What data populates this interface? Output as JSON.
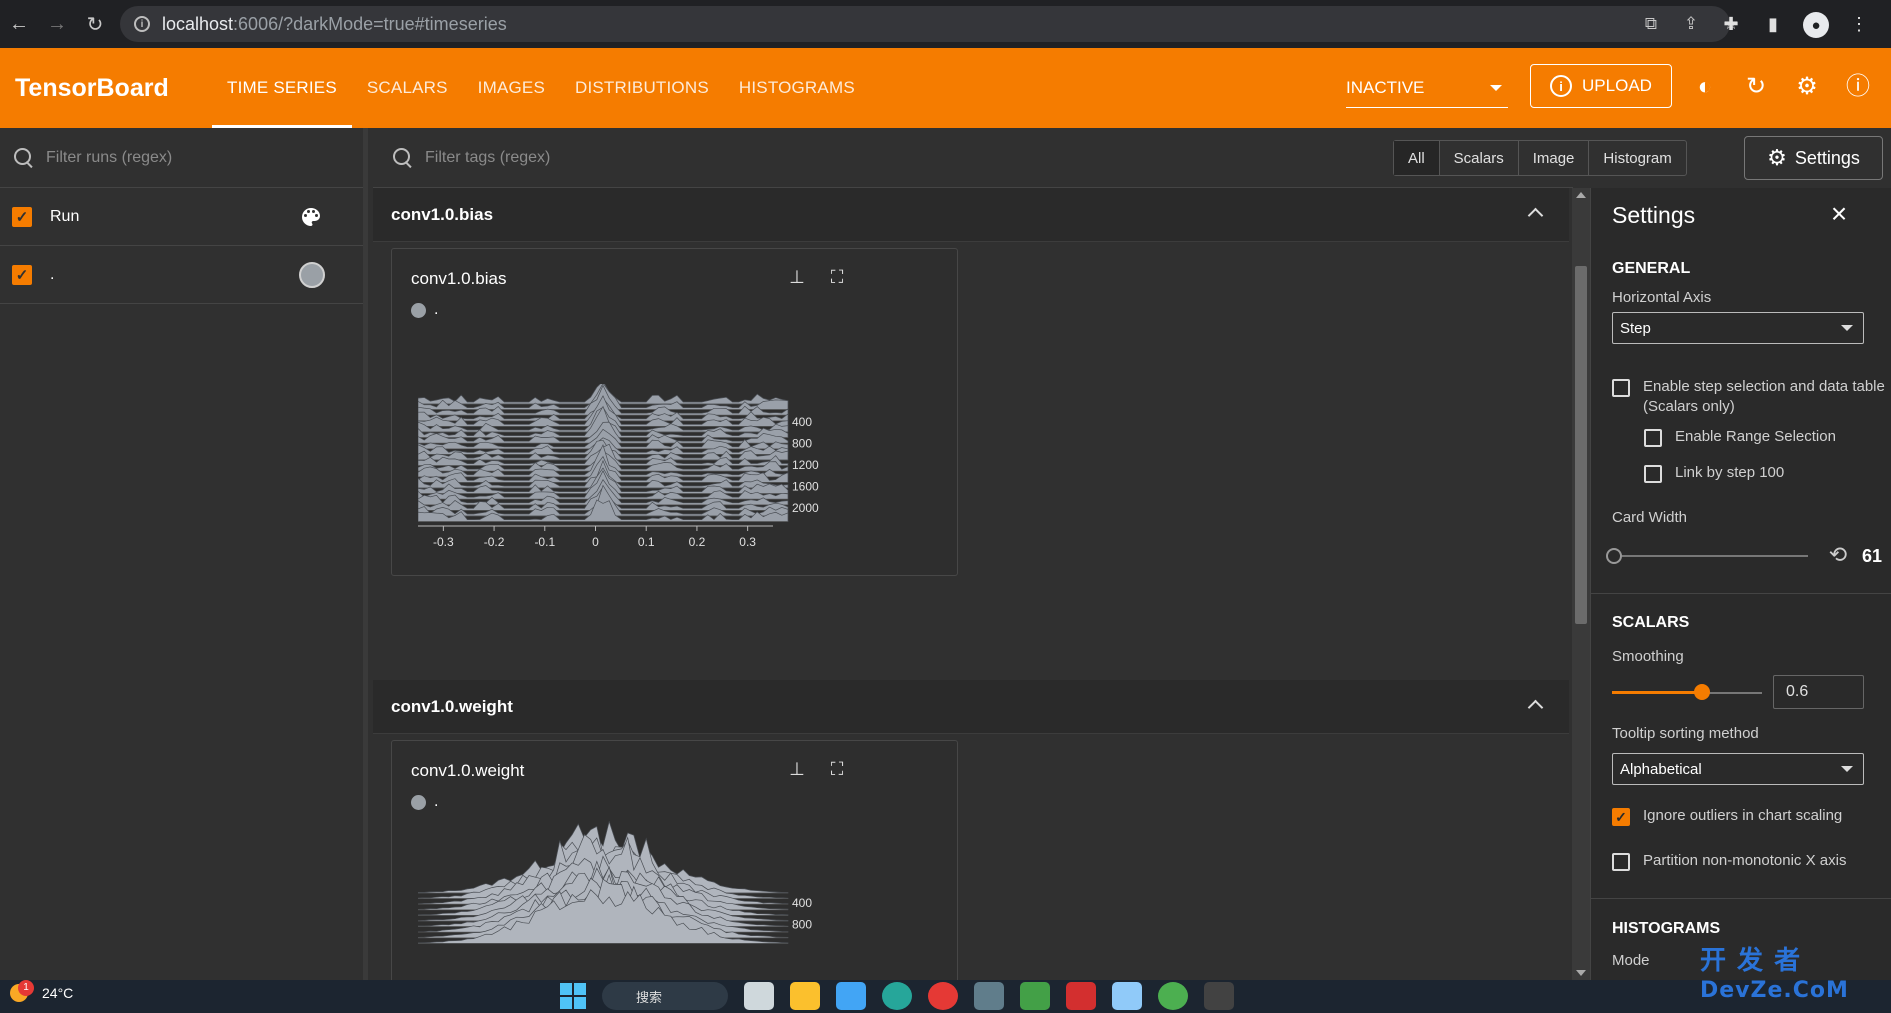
{
  "browser": {
    "url_host": "localhost",
    "url_rest": ":6006/?darkMode=true#timeseries"
  },
  "toolbar": {
    "brand": "TensorBoard",
    "tabs": [
      {
        "label": "TIME SERIES",
        "active": true
      },
      {
        "label": "SCALARS",
        "active": false
      },
      {
        "label": "IMAGES",
        "active": false
      },
      {
        "label": "DISTRIBUTIONS",
        "active": false
      },
      {
        "label": "HISTOGRAMS",
        "active": false
      }
    ],
    "status_select": "INACTIVE",
    "upload_label": "UPLOAD",
    "accent": "#f57c00"
  },
  "sidebar": {
    "filter_placeholder": "Filter runs (regex)",
    "runs": [
      {
        "label": "Run",
        "checked": true,
        "icon": "palette-icon"
      },
      {
        "label": ".",
        "checked": true,
        "color": "#9aa0a6"
      }
    ]
  },
  "main": {
    "filter_placeholder": "Filter tags (regex)",
    "type_filters": [
      "All",
      "Scalars",
      "Image",
      "Histogram"
    ],
    "settings_label": "Settings",
    "groups": [
      {
        "title": "conv1.0.bias",
        "card": {
          "title": "conv1.0.bias",
          "legend": ".",
          "chart_data": {
            "type": "histogram",
            "x_ticks": [
              "-0.3",
              "-0.2",
              "-0.1",
              "0",
              "0.1",
              "0.2",
              "0.3"
            ],
            "step_ticks": [
              "400",
              "800",
              "1200",
              "1600",
              "2000"
            ],
            "xlim": [
              -0.35,
              0.35
            ],
            "step_range": [
              0,
              2200
            ]
          }
        }
      },
      {
        "title": "conv1.0.weight",
        "card": {
          "title": "conv1.0.weight",
          "legend": ".",
          "chart_data": {
            "type": "histogram",
            "step_ticks": [
              "400",
              "800"
            ],
            "step_range": [
              0,
              2200
            ]
          }
        }
      }
    ]
  },
  "settings": {
    "title": "Settings",
    "general": "GENERAL",
    "horizontal_axis_label": "Horizontal Axis",
    "horizontal_axis_value": "Step",
    "step_selection_line1": "Enable step selection and data table",
    "step_selection_line2": "(Scalars only)",
    "range_selection": "Enable Range Selection",
    "link_by_step": "Link by step 100",
    "card_width_label": "Card Width",
    "card_width_cut": "61",
    "card_width_fraction": 0.0,
    "scalars": "SCALARS",
    "smoothing_label": "Smoothing",
    "smoothing_value": "0.6",
    "smoothing_fraction": 0.6,
    "tooltip_label": "Tooltip sorting method",
    "tooltip_value": "Alphabetical",
    "ignore_outliers": "Ignore outliers in chart scaling",
    "partition": "Partition non-monotonic X axis",
    "histograms": "HISTOGRAMS",
    "mode_label": "Mode"
  },
  "taskbar": {
    "weather": "24°C",
    "badge": "1",
    "search": "搜索"
  },
  "watermark": {
    "line1": "开 发 者",
    "line2": "DevZe.CoM"
  }
}
